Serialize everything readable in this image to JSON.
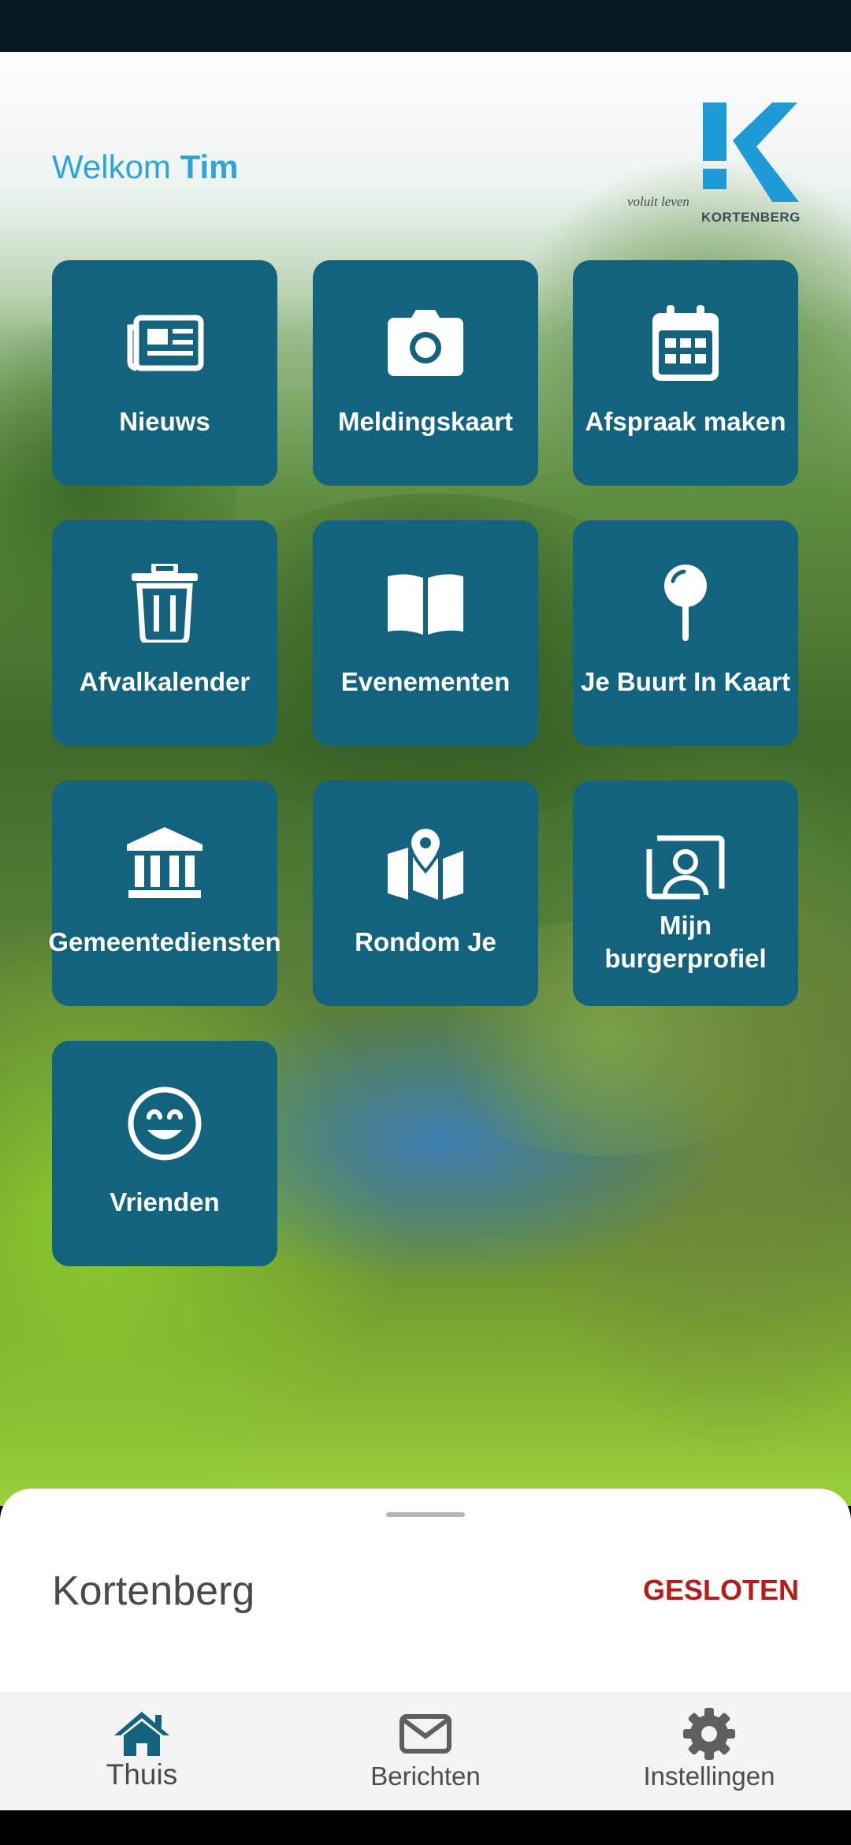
{
  "header": {
    "welcome": "Welkom",
    "user_name": "Tim"
  },
  "logo": {
    "tagline": "voluit leven",
    "name": "KORTENBERG"
  },
  "tiles": [
    {
      "label": "Nieuws",
      "icon": "newspaper-icon"
    },
    {
      "label": "Meldingskaart",
      "icon": "camera-icon"
    },
    {
      "label": "Afspraak maken",
      "icon": "calendar-icon"
    },
    {
      "label": "Afvalkalender",
      "icon": "trash-icon"
    },
    {
      "label": "Evenementen",
      "icon": "book-icon"
    },
    {
      "label": "Je Buurt In Kaart",
      "icon": "map-pin-icon"
    },
    {
      "label": "Gemeentediensten",
      "icon": "building-icon"
    },
    {
      "label": "Rondom Je",
      "icon": "map-marker-icon"
    },
    {
      "label": "Mijn burgerprofiel",
      "icon": "profile-card-icon"
    },
    {
      "label": "Vrienden",
      "icon": "smiley-icon"
    }
  ],
  "sheet": {
    "title": "Kortenberg",
    "status": "GESLOTEN"
  },
  "nav": [
    {
      "label": "Thuis",
      "icon": "home-icon",
      "active": true
    },
    {
      "label": "Berichten",
      "icon": "mail-icon",
      "active": false
    },
    {
      "label": "Instellingen",
      "icon": "gear-icon",
      "active": false
    }
  ],
  "colors": {
    "tile": "#13637f",
    "accent": "#2ea3dc",
    "status_closed": "#b61c1c"
  }
}
